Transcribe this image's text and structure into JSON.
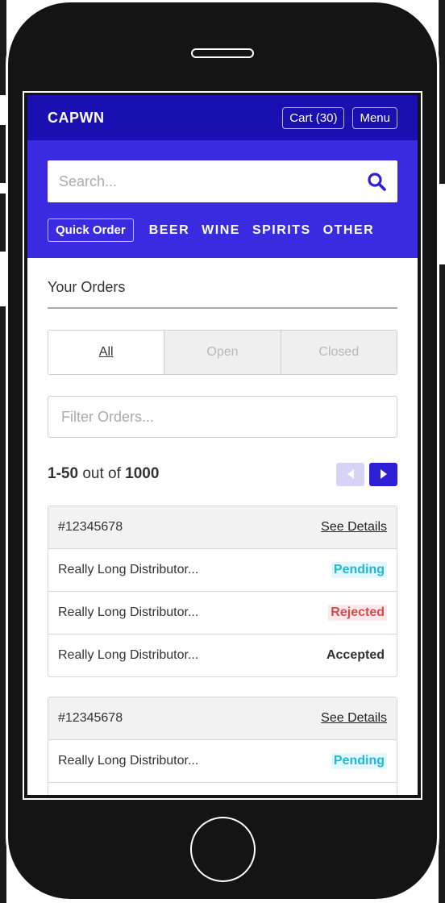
{
  "header": {
    "brand": "CAPWN",
    "cart_label": "Cart (30)",
    "menu_label": "Menu"
  },
  "search": {
    "placeholder": "Search..."
  },
  "categories": {
    "quick_order": "Quick Order",
    "items": [
      "BEER",
      "WINE",
      "SPIRITS",
      "OTHER"
    ]
  },
  "orders_section": {
    "title": "Your Orders",
    "tabs": [
      "All",
      "Open",
      "Closed"
    ],
    "filter_placeholder": "Filter Orders...",
    "pagination": {
      "range": "1-50",
      "out_of": "out of",
      "total": "1000"
    }
  },
  "orders": [
    {
      "id": "#12345678",
      "details_label": "See Details",
      "rows": [
        {
          "distributor": "Really Long Distributor...",
          "status": "Pending"
        },
        {
          "distributor": "Really Long Distributor...",
          "status": "Rejected"
        },
        {
          "distributor": "Really Long Distributor...",
          "status": "Accepted"
        }
      ]
    },
    {
      "id": "#12345678",
      "details_label": "See Details",
      "rows": [
        {
          "distributor": "Really Long Distributor...",
          "status": "Pending"
        },
        {
          "distributor": "",
          "status": ""
        }
      ]
    }
  ],
  "colors": {
    "topbar": "#1a0fb0",
    "search_zone": "#3a2be0",
    "pending": "#1fb7d6",
    "rejected": "#d24c4c"
  }
}
